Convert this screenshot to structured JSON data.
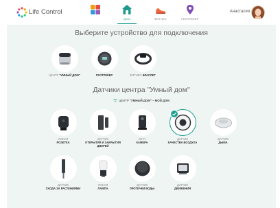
{
  "app": {
    "name": "Life Control"
  },
  "nav": [
    {
      "label": "",
      "icon": "widgets-icon",
      "active": false
    },
    {
      "label": "ДОМ",
      "icon": "home-icon",
      "active": true
    },
    {
      "label": "ФИТНЕС",
      "icon": "sneaker-icon",
      "active": false
    },
    {
      "label": "ГЕОТРЕКЕР",
      "icon": "location-pin-icon",
      "active": false
    }
  ],
  "user": {
    "name": "Анастасия"
  },
  "main": {
    "title": "Выберите устройство для подключения",
    "devices": [
      {
        "muted": "ЦЕНТР ",
        "bold": "\"УМНЫЙ ДОМ\"",
        "icon": "smart-home-hub-icon"
      },
      {
        "muted": "",
        "bold": "ГЕОТРЕКЕР",
        "icon": "geotracker-icon"
      },
      {
        "muted": "ФИТНЕС-",
        "bold": "БРАСЛЕТ",
        "icon": "fitness-band-icon"
      }
    ],
    "sensors_title": "Датчики центра \"Умный дом\"",
    "hub_line": {
      "prefix": "ЦЕНТР ",
      "name": "\"УМНЫЙ ДОМ\" – МОЙ ДОМ"
    },
    "sensors": [
      {
        "muted": "УМНАЯ",
        "bold": "РОЗЕТКА",
        "icon": "smart-socket-icon",
        "selected": false
      },
      {
        "muted": "ДАТЧИК",
        "bold": "ОТКРЫТИЯ И ЗАКРЫТИЯ ДВЕРЕЙ",
        "icon": "door-sensor-icon",
        "selected": false
      },
      {
        "muted": "WI-FI",
        "bold": "КАМЕРА",
        "icon": "wifi-camera-icon",
        "selected": false
      },
      {
        "muted": "ДАТЧИК",
        "bold": "КАЧЕСТВА ВОЗДУХА",
        "icon": "air-quality-sensor-icon",
        "selected": true
      },
      {
        "muted": "ДАТЧИК",
        "bold": "ДЫМА",
        "icon": "smoke-detector-icon",
        "selected": false
      },
      {
        "muted": "ДАТЧИК",
        "bold": "УХОДА ЗА РАСТЕНИЯМИ",
        "icon": "plant-sensor-icon",
        "selected": false
      },
      {
        "muted": "УМНАЯ",
        "bold": "ЛАМПА",
        "icon": "smart-lamp-icon",
        "selected": false
      },
      {
        "muted": "ДАТЧИК",
        "bold": "ПРОТЕЧКИ ВОДЫ",
        "icon": "water-leak-sensor-icon",
        "selected": false
      },
      {
        "muted": "ДАТЧИК",
        "bold": "ДВИЖЕНИЯ",
        "icon": "motion-sensor-icon",
        "selected": false
      }
    ]
  },
  "colors": {
    "accent": "#1d9a8c",
    "background": "#eef5f2"
  }
}
